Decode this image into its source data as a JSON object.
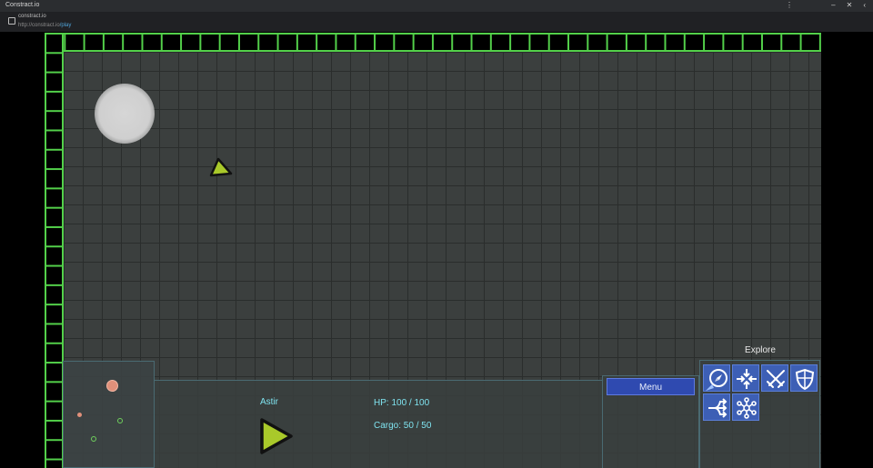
{
  "window": {
    "title": "Constract.io"
  },
  "address_bar": {
    "site": "constract.io",
    "url_prefix": "http://",
    "url_host": "constract.io",
    "url_path": "/play"
  },
  "hud": {
    "ship_name": "Astir",
    "hp_text": "HP: 100 / 100",
    "cargo_text": "Cargo: 50 / 50",
    "menu_label": "Menu",
    "action_title": "Explore",
    "actions": [
      {
        "icon": "compass-icon",
        "selected": true
      },
      {
        "icon": "collapse-arrows-icon",
        "selected": false
      },
      {
        "icon": "crossed-swords-icon",
        "selected": false
      },
      {
        "icon": "shield-icon",
        "selected": false
      },
      {
        "icon": "branching-arrows-icon",
        "selected": false
      },
      {
        "icon": "network-icon",
        "selected": false
      }
    ]
  },
  "colors": {
    "wall": "#53d04a",
    "grid_bg": "#3b3f3e",
    "hud_text": "#7fe3ef",
    "button_blue": "#3d5fb5",
    "ship_fill": "#a9c92a"
  }
}
